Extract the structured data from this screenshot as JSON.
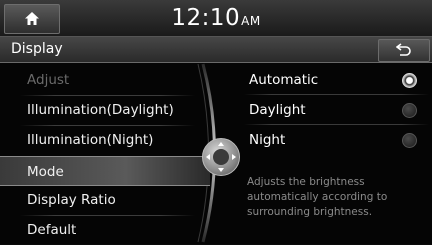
{
  "status_bar": {
    "time": "12:10",
    "ampm": "AM"
  },
  "header": {
    "title": "Display"
  },
  "menu": {
    "items": [
      {
        "label": "Adjust",
        "state": "disabled"
      },
      {
        "label": "Illumination(Daylight)",
        "state": "normal"
      },
      {
        "label": "Illumination(Night)",
        "state": "normal"
      },
      {
        "label": "Mode",
        "state": "selected"
      },
      {
        "label": "Display Ratio",
        "state": "normal"
      },
      {
        "label": "Default",
        "state": "normal"
      }
    ]
  },
  "mode_options": [
    {
      "label": "Automatic",
      "checked": true
    },
    {
      "label": "Daylight",
      "checked": false
    },
    {
      "label": "Night",
      "checked": false
    }
  ],
  "description": "Adjusts the brightness automatically according to surrounding brightness.",
  "icons": {
    "home": "home-icon",
    "back": "back-arrow-icon",
    "knob": "directional-knob-icon"
  }
}
